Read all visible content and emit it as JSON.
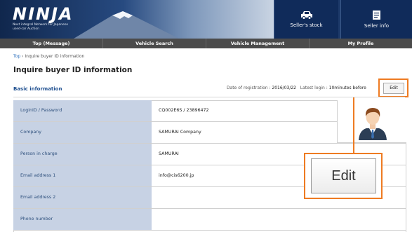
{
  "header": {
    "logo_word": "NINJA",
    "logo_tagline": "Next integral Network for Japanese used-car Auction",
    "seller_stock_label": "Seller's stock",
    "seller_info_label": "Seller info"
  },
  "nav": {
    "items": [
      {
        "label": "Top (Message)"
      },
      {
        "label": "Vehicle Search"
      },
      {
        "label": "Vehicle Management"
      },
      {
        "label": "My Profile"
      }
    ]
  },
  "breadcrumb": {
    "top": "Top",
    "separator": "›",
    "current": "Inquire buyer ID information"
  },
  "page_title": "Inquire buyer ID information",
  "section": {
    "title": "Basic information",
    "registration_label": "Date of registration :",
    "registration_value": "2016/03/22",
    "login_label": "Latest login :",
    "login_value": "10minutes before",
    "edit_label": "Edit"
  },
  "table": {
    "rows": [
      {
        "label": "LoginID / Password",
        "value": "CQ002E6S / 23896472"
      },
      {
        "label": "Company",
        "value": "SAMURAI Company"
      },
      {
        "label": "Person in charge",
        "value": "SAMURAI"
      },
      {
        "label": "Email address 1",
        "value": "info@cis6200.jp"
      },
      {
        "label": "Email address 2",
        "value": ""
      },
      {
        "label": "Phone number",
        "value": ""
      }
    ]
  },
  "callout": {
    "edit_label": "Edit"
  },
  "colors": {
    "accent": "#ee7b22",
    "header": "#1d3a6a",
    "label_bg": "#c7d2e4",
    "nav": "#4b4b4b"
  }
}
